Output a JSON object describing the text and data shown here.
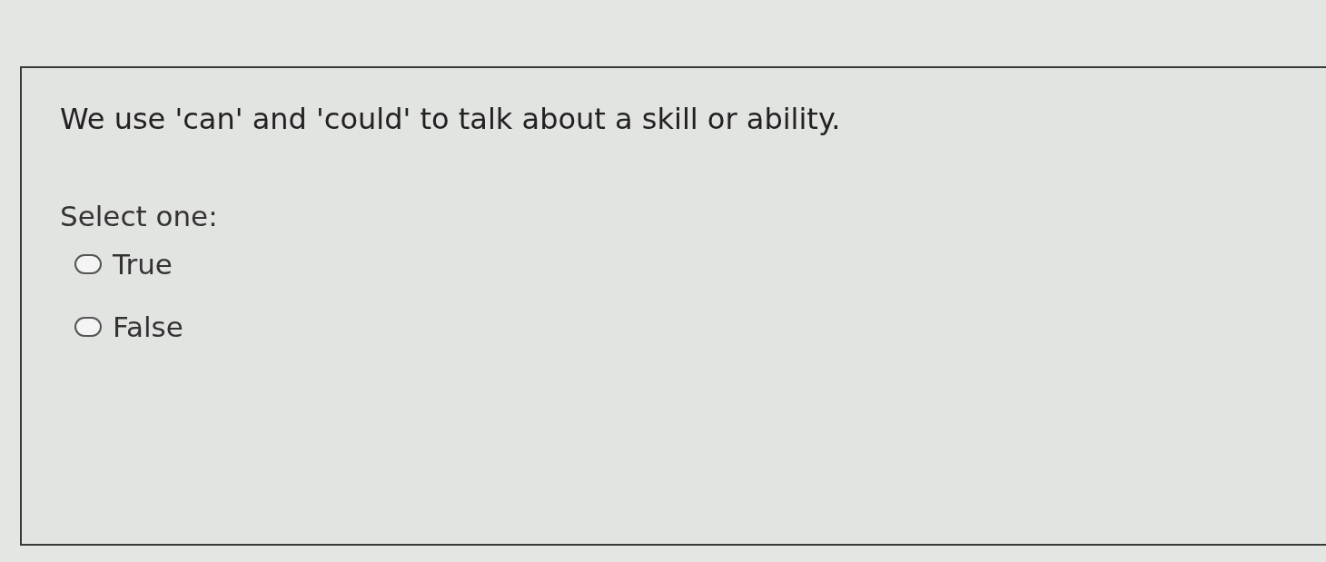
{
  "question": {
    "text": "We use 'can' and 'could' to talk about a skill or ability.",
    "prompt": "Select one:",
    "options": [
      {
        "label": "True",
        "selected": false
      },
      {
        "label": "False",
        "selected": false
      }
    ]
  }
}
